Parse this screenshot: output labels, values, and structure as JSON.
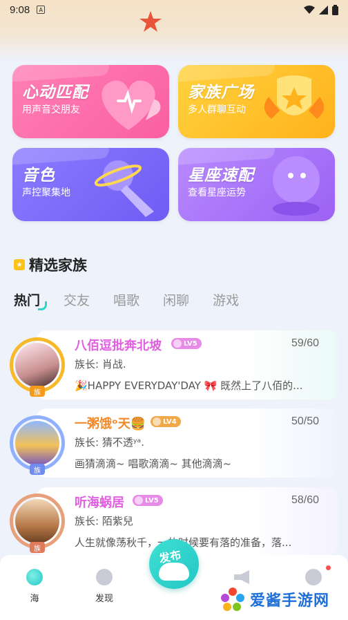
{
  "status_bar": {
    "time": "9:08",
    "notif_letter": "A"
  },
  "feature_cards": [
    {
      "title": "心动匹配",
      "subtitle": "用声音交朋友",
      "icon": "heart-icon",
      "color": "#fa5fa2"
    },
    {
      "title": "家族广场",
      "subtitle": "多人群聊互动",
      "icon": "star-shield-icon",
      "color": "#ffb21c"
    },
    {
      "title": "音色",
      "subtitle": "声控聚集地",
      "icon": "microphone-icon",
      "color": "#6f5cf4"
    },
    {
      "title": "星座速配",
      "subtitle": "查看星座运势",
      "icon": "crystal-ball-icon",
      "color": "#9c62f4"
    }
  ],
  "section": {
    "title": "精选家族"
  },
  "tabs": [
    {
      "label": "热门",
      "active": true
    },
    {
      "label": "交友",
      "active": false
    },
    {
      "label": "唱歌",
      "active": false
    },
    {
      "label": "闲聊",
      "active": false
    },
    {
      "label": "游戏",
      "active": false
    }
  ],
  "families": [
    {
      "name": "八佰逗批奔北坡",
      "level": "LV5",
      "count": "59/60",
      "leader": "族长: 肖战.",
      "desc": "🎉HAPPY EVERYDAY'DAY 🎀    既然上了八佰的...",
      "badge": "族",
      "name_color": "#e05fe0"
    },
    {
      "name": "一粥饿ᵒ天🍔",
      "level": "LV4",
      "count": "50/50",
      "leader": "族长: 猜不透ʸᵃ.",
      "desc": "画猜滴滴~ 唱歌滴滴~ 其他滴滴~",
      "badge": "族",
      "name_color": "#f08a2a"
    },
    {
      "name": "听海蜗居",
      "level": "LV5",
      "count": "58/60",
      "leader": "族长: 陌紫兒",
      "desc": "人生就像荡秋千，一的时候要有落的准备，落...",
      "badge": "族",
      "name_color": "#e05fe0"
    }
  ],
  "bottom_nav": {
    "items": [
      {
        "label": "海",
        "icon": "sea-icon"
      },
      {
        "label": "发现",
        "icon": "compass-icon"
      },
      {
        "label": "",
        "icon": "megaphone-icon"
      },
      {
        "label": "",
        "icon": "chat-face-icon"
      }
    ],
    "publish_label": "发布"
  },
  "watermark": {
    "text": "爱酱手游网"
  }
}
